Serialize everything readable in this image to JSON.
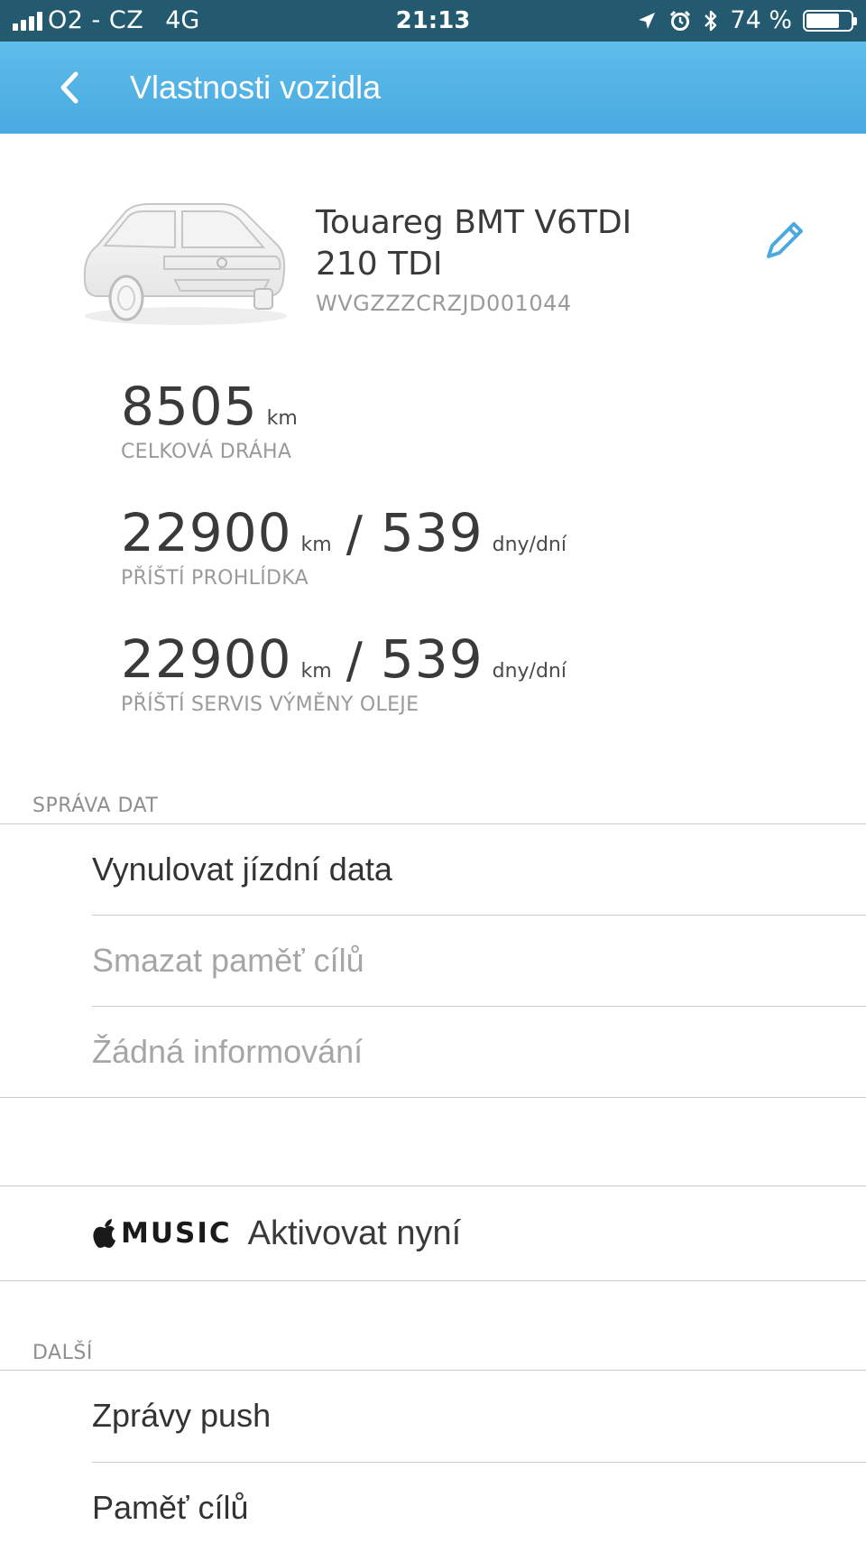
{
  "status_bar": {
    "carrier": "O2 - CZ",
    "network": "4G",
    "time": "21:13",
    "battery_text": "74 %",
    "battery_level": 0.74,
    "icons": [
      "signal-icon",
      "location-arrow-icon",
      "alarm-icon",
      "bluetooth-icon",
      "battery-icon"
    ]
  },
  "header": {
    "title": "Vlastnosti vozidla",
    "back_icon": "chevron-left-icon",
    "background": "#4fb0e4"
  },
  "vehicle": {
    "name_line1": "Touareg BMT V6TDI",
    "name_line2": "210 TDI",
    "vin": "WVGZZZCRZJD001044",
    "edit_icon": "pencil-icon",
    "accent": "#4aa9e0"
  },
  "stats": {
    "total_distance": {
      "value": "8505",
      "unit": "km",
      "caption": "CELKOVÁ DRÁHA"
    },
    "next_inspection": {
      "km": "22900",
      "km_unit": "km",
      "separator": "/",
      "days": "539",
      "days_unit": "dny/dní",
      "caption": "PŘÍŠTÍ PROHLÍDKA"
    },
    "next_oil_service": {
      "km": "22900",
      "km_unit": "km",
      "separator": "/",
      "days": "539",
      "days_unit": "dny/dní",
      "caption": "PŘÍŠTÍ SERVIS VÝMĚNY OLEJE"
    }
  },
  "data_management": {
    "heading": "SPRÁVA DAT",
    "items": [
      {
        "label": "Vynulovat jízdní data",
        "enabled": true
      },
      {
        "label": "Smazat paměť cílů",
        "enabled": false
      },
      {
        "label": "Žádná informování",
        "enabled": false
      }
    ]
  },
  "music": {
    "logo_text": "MUSIC",
    "logo_icon": "apple-logo-icon",
    "action": "Aktivovat nyní"
  },
  "more": {
    "heading": "DALŠÍ",
    "items": [
      {
        "label": "Zprávy push"
      },
      {
        "label": "Paměť cílů"
      }
    ]
  }
}
